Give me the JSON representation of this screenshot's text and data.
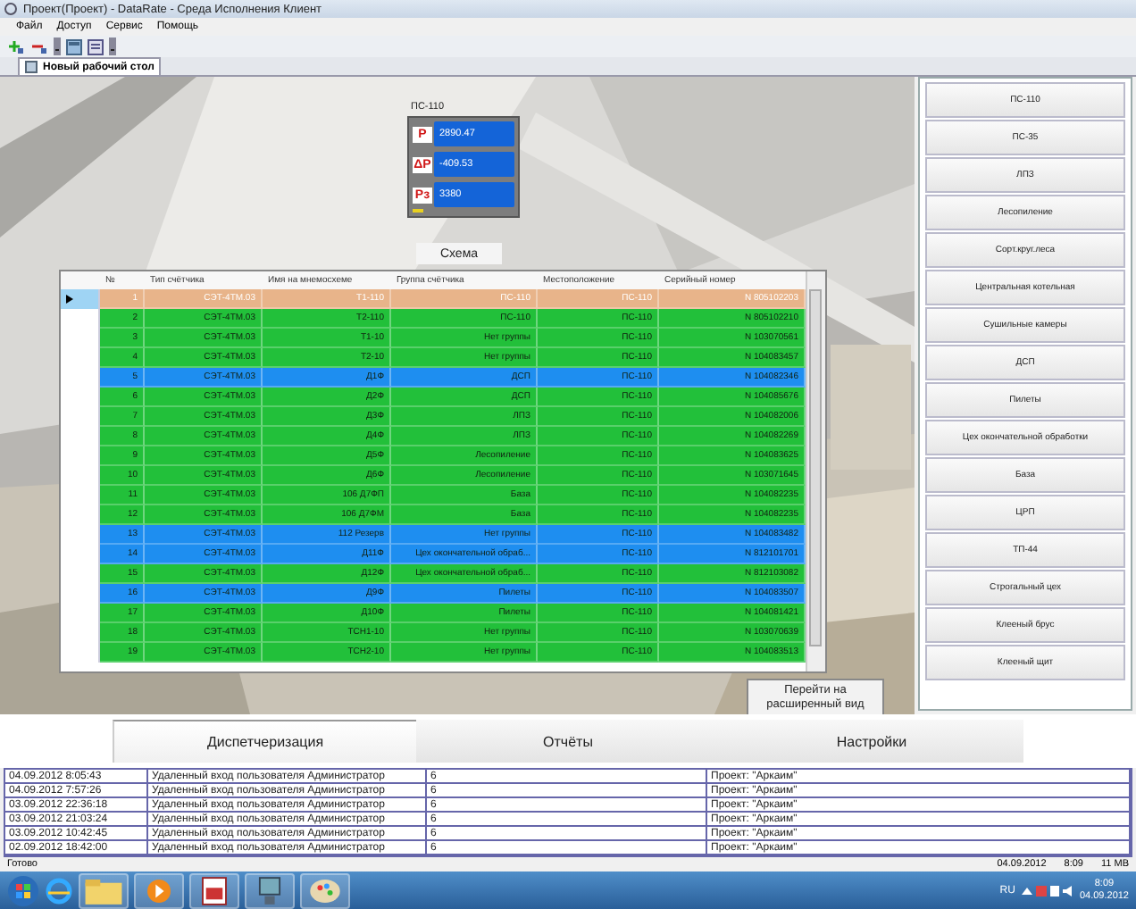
{
  "window": {
    "title": "Проект(Проект) - DataRate - Среда Исполнения Клиент"
  },
  "menu": [
    "Файл",
    "Доступ",
    "Сервис",
    "Помощь"
  ],
  "workspace_tab": {
    "label": "Новый рабочий стол"
  },
  "substation_panel": {
    "title": "ПС-110",
    "readings": [
      {
        "symbol": "P",
        "value": "2890.47"
      },
      {
        "symbol": "ΔP",
        "value": "-409.53"
      },
      {
        "symbol": "Pз",
        "value": "3380"
      }
    ]
  },
  "scheme_button": "Схема",
  "meter_table": {
    "columns": [
      "№",
      "Тип счётчика",
      "Имя на мнемосхеме",
      "Группа счётчика",
      "Местоположение",
      "Серийный номер"
    ],
    "rows": [
      {
        "cells": [
          "1",
          "СЭТ-4ТМ.03",
          "Т1-110",
          "ПС-110",
          "ПС-110",
          "N 805102203"
        ],
        "color": "#e8b48a",
        "selected": true
      },
      {
        "cells": [
          "2",
          "СЭТ-4ТМ.03",
          "Т2-110",
          "ПС-110",
          "ПС-110",
          "N 805102210"
        ],
        "color": "#22c03a",
        "selected": false
      },
      {
        "cells": [
          "3",
          "СЭТ-4ТМ.03",
          "Т1-10",
          "Нет группы",
          "ПС-110",
          "N 103070561"
        ],
        "color": "#22c03a",
        "selected": false
      },
      {
        "cells": [
          "4",
          "СЭТ-4ТМ.03",
          "Т2-10",
          "Нет группы",
          "ПС-110",
          "N 104083457"
        ],
        "color": "#22c03a",
        "selected": false
      },
      {
        "cells": [
          "5",
          "СЭТ-4ТМ.03",
          "Д1Ф",
          "ДСП",
          "ПС-110",
          "N 104082346"
        ],
        "color": "#1e8ef0",
        "selected": false
      },
      {
        "cells": [
          "6",
          "СЭТ-4ТМ.03",
          "Д2Ф",
          "ДСП",
          "ПС-110",
          "N 104085676"
        ],
        "color": "#22c03a",
        "selected": false
      },
      {
        "cells": [
          "7",
          "СЭТ-4ТМ.03",
          "Д3Ф",
          "ЛПЗ",
          "ПС-110",
          "N 104082006"
        ],
        "color": "#22c03a",
        "selected": false
      },
      {
        "cells": [
          "8",
          "СЭТ-4ТМ.03",
          "Д4Ф",
          "ЛПЗ",
          "ПС-110",
          "N 104082269"
        ],
        "color": "#22c03a",
        "selected": false
      },
      {
        "cells": [
          "9",
          "СЭТ-4ТМ.03",
          "Д5Ф",
          "Лесопиление",
          "ПС-110",
          "N 104083625"
        ],
        "color": "#22c03a",
        "selected": false
      },
      {
        "cells": [
          "10",
          "СЭТ-4ТМ.03",
          "Д6Ф",
          "Лесопиление",
          "ПС-110",
          "N 103071645"
        ],
        "color": "#22c03a",
        "selected": false
      },
      {
        "cells": [
          "11",
          "СЭТ-4ТМ.03",
          "106 Д7ФП",
          "База",
          "ПС-110",
          "N 104082235"
        ],
        "color": "#22c03a",
        "selected": false
      },
      {
        "cells": [
          "12",
          "СЭТ-4ТМ.03",
          "106 Д7ФМ",
          "База",
          "ПС-110",
          "N 104082235"
        ],
        "color": "#22c03a",
        "selected": false
      },
      {
        "cells": [
          "13",
          "СЭТ-4ТМ.03",
          "112 Резерв",
          "Нет группы",
          "ПС-110",
          "N 104083482"
        ],
        "color": "#1e8ef0",
        "selected": false
      },
      {
        "cells": [
          "14",
          "СЭТ-4ТМ.03",
          "Д11Ф",
          "Цех окончательной обраб...",
          "ПС-110",
          "N 812101701"
        ],
        "color": "#1e8ef0",
        "selected": false
      },
      {
        "cells": [
          "15",
          "СЭТ-4ТМ.03",
          "Д12Ф",
          "Цех окончательной обраб...",
          "ПС-110",
          "N 812103082"
        ],
        "color": "#22c03a",
        "selected": false
      },
      {
        "cells": [
          "16",
          "СЭТ-4ТМ.03",
          "Д9Ф",
          "Пилеты",
          "ПС-110",
          "N 104083507"
        ],
        "color": "#1e8ef0",
        "selected": false
      },
      {
        "cells": [
          "17",
          "СЭТ-4ТМ.03",
          "Д10Ф",
          "Пилеты",
          "ПС-110",
          "N 104081421"
        ],
        "color": "#22c03a",
        "selected": false
      },
      {
        "cells": [
          "18",
          "СЭТ-4ТМ.03",
          "ТСН1-10",
          "Нет группы",
          "ПС-110",
          "N 103070639"
        ],
        "color": "#22c03a",
        "selected": false
      },
      {
        "cells": [
          "19",
          "СЭТ-4ТМ.03",
          "ТСН2-10",
          "Нет группы",
          "ПС-110",
          "N 104083513"
        ],
        "color": "#22c03a",
        "selected": false
      }
    ]
  },
  "expand_button": "Перейти на расширенный вид",
  "sidebar": {
    "items": [
      "ПС-110",
      "ПС-35",
      "ЛПЗ",
      "Лесопиление",
      "Сорт.круг.леса",
      "Центральная котельная",
      "Сушильные камеры",
      "ДСП",
      "Пилеты",
      "Цех окончательной обработки",
      "База",
      "ЦРП",
      "ТП-44",
      "Строгальный цех",
      "Клееный брус",
      "Клееный щит"
    ]
  },
  "bottom_tabs": [
    {
      "label": "Диспетчеризация",
      "selected": true
    },
    {
      "label": "Отчёты",
      "selected": false
    },
    {
      "label": "Настройки",
      "selected": false
    }
  ],
  "log": {
    "rows": [
      [
        "04.09.2012 8:05:43",
        "Удаленный вход пользователя Администратор",
        "6",
        "Проект: \"Аркаим\""
      ],
      [
        "04.09.2012 7:57:26",
        "Удаленный вход пользователя Администратор",
        "6",
        "Проект: \"Аркаим\""
      ],
      [
        "03.09.2012 22:36:18",
        "Удаленный вход пользователя Администратор",
        "6",
        "Проект: \"Аркаим\""
      ],
      [
        "03.09.2012 21:03:24",
        "Удаленный вход пользователя Администратор",
        "6",
        "Проект: \"Аркаим\""
      ],
      [
        "03.09.2012 10:42:45",
        "Удаленный вход пользователя Администратор",
        "6",
        "Проект: \"Аркаим\""
      ],
      [
        "02.09.2012 18:42:00",
        "Удаленный вход пользователя Администратор",
        "6",
        "Проект: \"Аркаим\""
      ]
    ]
  },
  "status_bar": {
    "text": "Готово",
    "date": "04.09.2012",
    "time": "8:09",
    "memory": "11 MB"
  },
  "taskbar": {
    "language": "RU",
    "time": "8:09",
    "date": "04.09.2012"
  }
}
